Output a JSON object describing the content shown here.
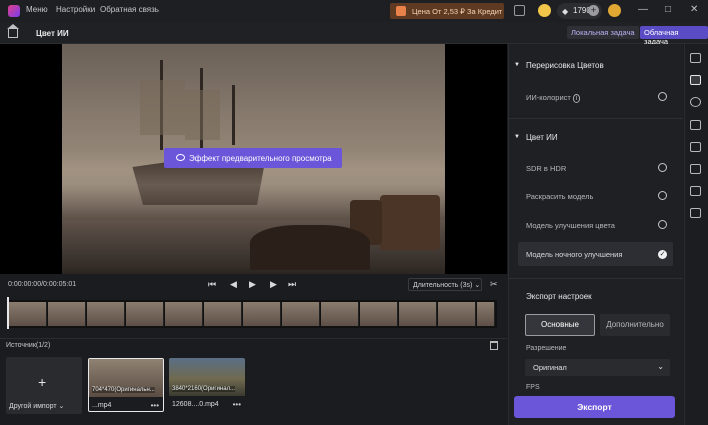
{
  "topbar": {
    "menu": [
      "Меню",
      "Настройки",
      "Обратная связь"
    ],
    "promo": "Цена От 2,53 ₽ За Кредит",
    "credits": "1790",
    "window_controls": [
      "—",
      "□",
      "✕"
    ]
  },
  "tabbar": {
    "title": "Цвет ИИ",
    "tabs": [
      "Локальная задача",
      "Облачная задача"
    ]
  },
  "preview": {
    "button_label": "Эффект предварительного просмотра"
  },
  "controls": {
    "timecode": "0:00:00:00/0:00:05:01",
    "duration": "Длительность (3s)",
    "icons": [
      "skip-back",
      "step-back",
      "play",
      "step-forward",
      "skip-forward"
    ]
  },
  "sources": {
    "label": "Источник(1/2)",
    "import_label": "Другой импорт",
    "items": [
      {
        "res": "704*470(Оригинальн...",
        "name": "...mp4",
        "selected": true
      },
      {
        "res": "3840*2160(Оригинал...",
        "name": "12608....0.mp4",
        "selected": false
      }
    ]
  },
  "panel": {
    "section1": "Перерисовка Цветов",
    "s1_options": [
      "ИИ-колорист"
    ],
    "section2": "Цвет ИИ",
    "s2_options": [
      "SDR в HDR",
      "Раскрасить модель",
      "Модель улучшения цвета",
      "Модель ночного улучшения"
    ],
    "selected_option": "Модель ночного улучшения",
    "export_settings": "Экспорт настроек",
    "basic": "Основные",
    "advanced": "Дополнительно",
    "resolution_label": "Разрешение",
    "resolution_value": "Оригинал",
    "fps_label": "FPS",
    "export_button": "Экспорт"
  },
  "colors": {
    "accent": "#6b55d8",
    "promo_bg": "#5e3a22"
  }
}
